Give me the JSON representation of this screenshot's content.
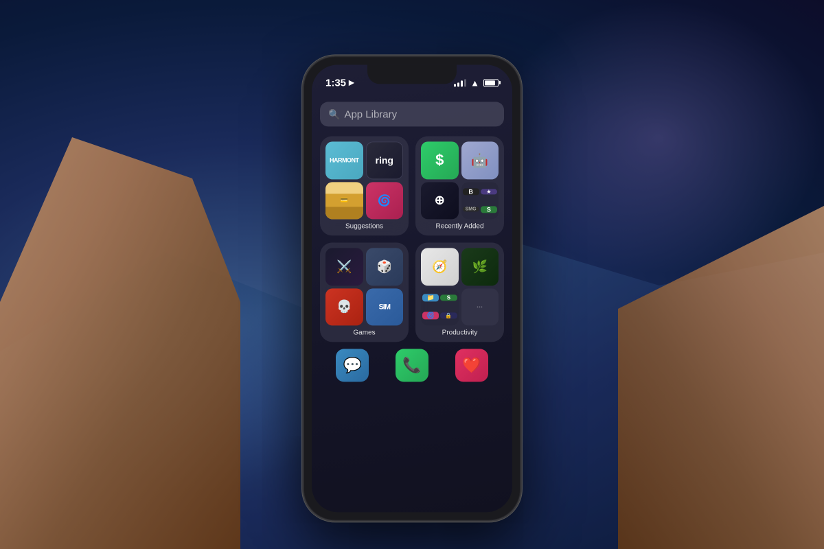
{
  "background": {
    "description": "Blurred desktop wallpaper with mountain landscape"
  },
  "phone": {
    "status_bar": {
      "time": "1:35",
      "location_icon": "▶",
      "signal_bars": [
        3,
        5,
        7,
        9,
        11
      ],
      "wifi": "wifi",
      "battery": "battery"
    },
    "search_bar": {
      "placeholder": "App Library",
      "icon": "🔍"
    },
    "folders": [
      {
        "id": "suggestions",
        "label": "Suggestions",
        "apps": [
          {
            "name": "Harmony",
            "style": "harmony",
            "display": "HARMONT"
          },
          {
            "name": "Ring",
            "style": "ring",
            "display": "ring"
          },
          {
            "name": "Cash App",
            "style": "cash",
            "display": "$"
          },
          {
            "name": "Bot",
            "style": "bot",
            "display": "🤖"
          },
          {
            "name": "Wallet",
            "style": "wallet",
            "display": "💳"
          },
          {
            "name": "Nova",
            "style": "nova",
            "display": "🌀"
          }
        ],
        "bottom_row": [
          {
            "name": "Loupe",
            "style": "loupe",
            "display": "⊕"
          },
          {
            "name": "Multi",
            "style": "multi"
          }
        ]
      },
      {
        "id": "recently-added",
        "label": "Recently Added",
        "apps": [
          {
            "name": "Cash App",
            "style": "cash",
            "display": "$"
          },
          {
            "name": "Bot",
            "style": "bot",
            "display": "🤖"
          },
          {
            "name": "B",
            "style": "mini-b",
            "display": "B"
          },
          {
            "name": "S",
            "style": "mini-s",
            "display": "S"
          }
        ]
      },
      {
        "id": "games",
        "label": "Games",
        "apps": [
          {
            "name": "Final Fantasy",
            "style": "ff",
            "display": "⚔️"
          },
          {
            "name": "Dice",
            "style": "dice",
            "display": "🎲"
          },
          {
            "name": "Skull",
            "style": "skull",
            "display": "💀"
          },
          {
            "name": "Sim",
            "style": "sim",
            "display": "SIM"
          }
        ]
      },
      {
        "id": "productivity",
        "label": "Productivity",
        "apps": [
          {
            "name": "Safari",
            "style": "safari",
            "display": "🧭"
          },
          {
            "name": "Robinhood",
            "style": "robinhood",
            "display": "🌿"
          },
          {
            "name": "Files",
            "style": "files-multi"
          },
          {
            "name": "Multi2",
            "style": "multi2"
          }
        ]
      }
    ],
    "bottom_dock": {
      "apps": [
        "messages",
        "phone",
        "health"
      ]
    }
  }
}
